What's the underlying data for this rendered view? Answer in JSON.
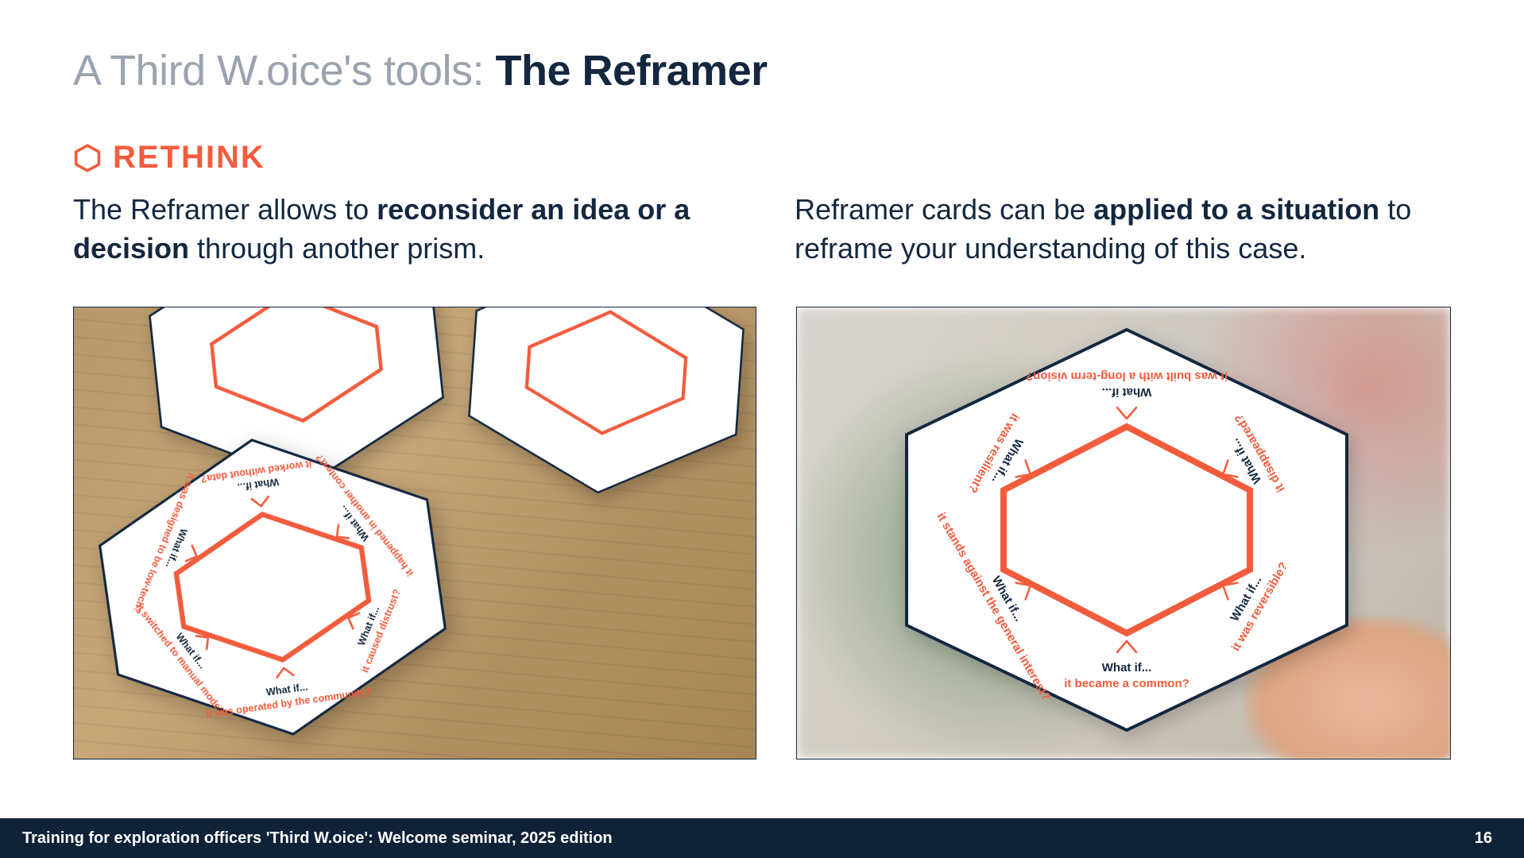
{
  "title": {
    "prefix": "A Third W.oice's tools: ",
    "bold": "The Reframer"
  },
  "section": {
    "label": "RETHINK"
  },
  "para_left": {
    "t1": "The Reframer allows to ",
    "b1": "reconsider an idea or a decision",
    "t2": " through another prism."
  },
  "para_right": {
    "t1": "Reframer cards can be ",
    "b1": "applied to a situation",
    "t2": " to reframe your understanding of this case."
  },
  "card_prompts": {
    "what_if": "What if...",
    "left_bottom": "it was operated by the community?",
    "left_bottom_left": "it switched to manual mode?",
    "left_top_left": "it was designed to be low-tech?",
    "left_top": "it worked without data?",
    "left_top_right": "it happened in another context?",
    "left_bottom_right": "it caused distrust?",
    "right_bottom": "it became a common?",
    "right_bottom_right": "it was reversible?",
    "right_top_right": "it disappeared?",
    "right_top": "it was built with a long-term vision?",
    "right_top_left": "it was resilient?",
    "right_bottom_left": "it stands against the general interest?"
  },
  "footer": {
    "text": "Training for exploration officers 'Third W.oice': Welcome seminar, 2025 edition",
    "page": "16"
  }
}
